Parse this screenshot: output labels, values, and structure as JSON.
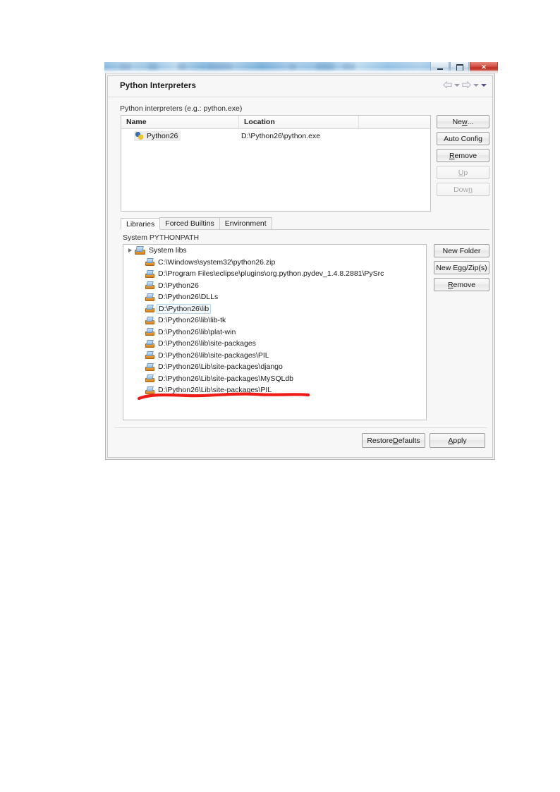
{
  "window": {
    "controls": {
      "minimize": "minimize-button",
      "maximize": "maximize-button",
      "close": "✕"
    }
  },
  "header": {
    "title": "Python Interpreters",
    "nav_icons": [
      "back-arrow-icon",
      "chevron-down-icon",
      "forward-arrow-icon",
      "chevron-down-icon",
      "menu-chevron-down-icon"
    ]
  },
  "interpreters": {
    "label": "Python interpreters (e.g.: python.exe)",
    "columns": [
      "Name",
      "Location",
      ""
    ],
    "rows": [
      {
        "name": "Python26",
        "location": "D:\\Python26\\python.exe"
      }
    ],
    "buttons": [
      {
        "label": "New...",
        "mnemonic": "N",
        "enabled": true
      },
      {
        "label": "Auto Config",
        "mnemonic": "",
        "enabled": true
      },
      {
        "label": "Remove",
        "mnemonic": "R",
        "enabled": true
      },
      {
        "label": "Up",
        "mnemonic": "U",
        "enabled": false
      },
      {
        "label": "Down",
        "mnemonic": "n",
        "enabled": false
      }
    ]
  },
  "tabs": [
    {
      "label": "Libraries",
      "active": true
    },
    {
      "label": "Forced Builtins",
      "active": false
    },
    {
      "label": "Environment",
      "active": false
    }
  ],
  "libraries": {
    "syspath_label": "System PYTHONPATH",
    "root": {
      "label": "System libs",
      "expanded": true
    },
    "items": [
      {
        "label": "C:\\Windows\\system32\\python26.zip",
        "selected": false
      },
      {
        "label": "D:\\Program Files\\eclipse\\plugins\\org.python.pydev_1.4.8.2881\\PySrc",
        "selected": false
      },
      {
        "label": "D:\\Python26",
        "selected": false
      },
      {
        "label": "D:\\Python26\\DLLs",
        "selected": false
      },
      {
        "label": "D:\\Python26\\lib",
        "selected": true
      },
      {
        "label": "D:\\Python26\\lib\\lib-tk",
        "selected": false
      },
      {
        "label": "D:\\Python26\\lib\\plat-win",
        "selected": false
      },
      {
        "label": "D:\\Python26\\lib\\site-packages",
        "selected": false
      },
      {
        "label": "D:\\Python26\\lib\\site-packages\\PIL",
        "selected": false
      },
      {
        "label": "D:\\Python26\\Lib\\site-packages\\django",
        "selected": false
      },
      {
        "label": "D:\\Python26\\Lib\\site-packages\\MySQLdb",
        "selected": false
      },
      {
        "label": "D:\\Python26\\Lib\\site-packages\\PIL",
        "selected": false
      }
    ],
    "buttons": [
      {
        "label": "New Folder",
        "mnemonic": "",
        "enabled": true
      },
      {
        "label": "New Egg/Zip(s)",
        "mnemonic": "",
        "enabled": true
      },
      {
        "label": "Remove",
        "mnemonic": "R",
        "enabled": true
      }
    ]
  },
  "footer": {
    "restore_label": "Restore Defaults",
    "restore_mnemonic": "D",
    "apply_label": "Apply",
    "apply_mnemonic": "A"
  },
  "annotation": {
    "color": "#ee1b17",
    "target": "D:\\Python26\\Lib\\site-packages\\MySQLdb"
  }
}
